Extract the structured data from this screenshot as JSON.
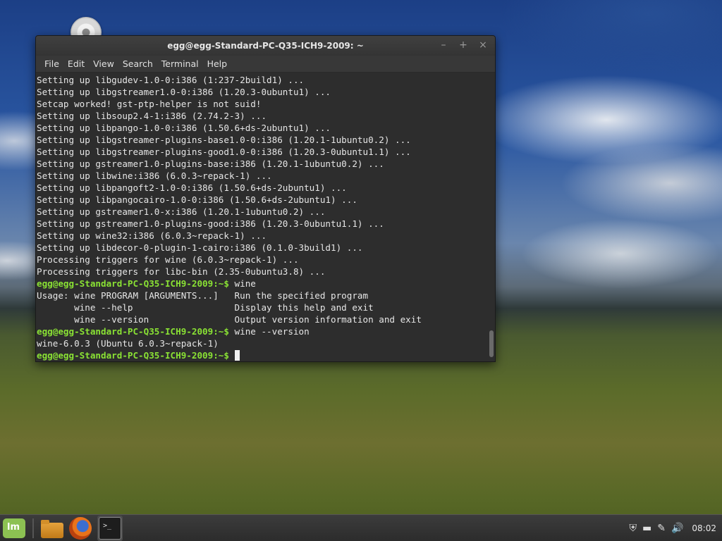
{
  "window": {
    "title": "egg@egg-Standard-PC-Q35-ICH9-2009: ~",
    "controls": {
      "minimize": "–",
      "maximize": "+",
      "close": "×"
    }
  },
  "menubar": {
    "items": [
      "File",
      "Edit",
      "View",
      "Search",
      "Terminal",
      "Help"
    ]
  },
  "terminal": {
    "prompt": "egg@egg-Standard-PC-Q35-ICH9-2009:~$",
    "lines": [
      {
        "text": "Setting up libgudev-1.0-0:i386 (1:237-2build1) ..."
      },
      {
        "text": "Setting up libgstreamer1.0-0:i386 (1.20.3-0ubuntu1) ..."
      },
      {
        "text": "Setcap worked! gst-ptp-helper is not suid!"
      },
      {
        "text": "Setting up libsoup2.4-1:i386 (2.74.2-3) ..."
      },
      {
        "text": "Setting up libpango-1.0-0:i386 (1.50.6+ds-2ubuntu1) ..."
      },
      {
        "text": "Setting up libgstreamer-plugins-base1.0-0:i386 (1.20.1-1ubuntu0.2) ..."
      },
      {
        "text": "Setting up libgstreamer-plugins-good1.0-0:i386 (1.20.3-0ubuntu1.1) ..."
      },
      {
        "text": "Setting up gstreamer1.0-plugins-base:i386 (1.20.1-1ubuntu0.2) ..."
      },
      {
        "text": "Setting up libwine:i386 (6.0.3~repack-1) ..."
      },
      {
        "text": "Setting up libpangoft2-1.0-0:i386 (1.50.6+ds-2ubuntu1) ..."
      },
      {
        "text": "Setting up libpangocairo-1.0-0:i386 (1.50.6+ds-2ubuntu1) ..."
      },
      {
        "text": "Setting up gstreamer1.0-x:i386 (1.20.1-1ubuntu0.2) ..."
      },
      {
        "text": "Setting up gstreamer1.0-plugins-good:i386 (1.20.3-0ubuntu1.1) ..."
      },
      {
        "text": "Setting up wine32:i386 (6.0.3~repack-1) ..."
      },
      {
        "text": "Setting up libdecor-0-plugin-1-cairo:i386 (0.1.0-3build1) ..."
      },
      {
        "text": "Processing triggers for wine (6.0.3~repack-1) ..."
      },
      {
        "text": "Processing triggers for libc-bin (2.35-0ubuntu3.8) ..."
      },
      {
        "prompt": "egg@egg-Standard-PC-Q35-ICH9-2009:~$",
        "text": " wine"
      },
      {
        "text": "Usage: wine PROGRAM [ARGUMENTS...]   Run the specified program"
      },
      {
        "text": "       wine --help                   Display this help and exit"
      },
      {
        "text": "       wine --version                Output version information and exit"
      },
      {
        "prompt": "egg@egg-Standard-PC-Q35-ICH9-2009:~$",
        "text": " wine --version"
      },
      {
        "text": "wine-6.0.3 (Ubuntu 6.0.3~repack-1)"
      },
      {
        "prompt": "egg@egg-Standard-PC-Q35-ICH9-2009:~$",
        "text": " ",
        "cursor": true
      }
    ]
  },
  "taskbar": {
    "launchers": [
      "mint-menu-icon",
      "folder-icon",
      "firefox-icon",
      "terminal-icon"
    ],
    "terminal_glyph": ">_",
    "tray": {
      "shield": "⛨",
      "display": "▬",
      "edit": "✎",
      "volume": "🔊"
    },
    "clock": "08:02"
  },
  "colors": {
    "prompt": "#8ae234",
    "terminal_bg": "#2d2d2d",
    "titlebar": "#3a3a3a",
    "mint_green": "#8cc152"
  }
}
